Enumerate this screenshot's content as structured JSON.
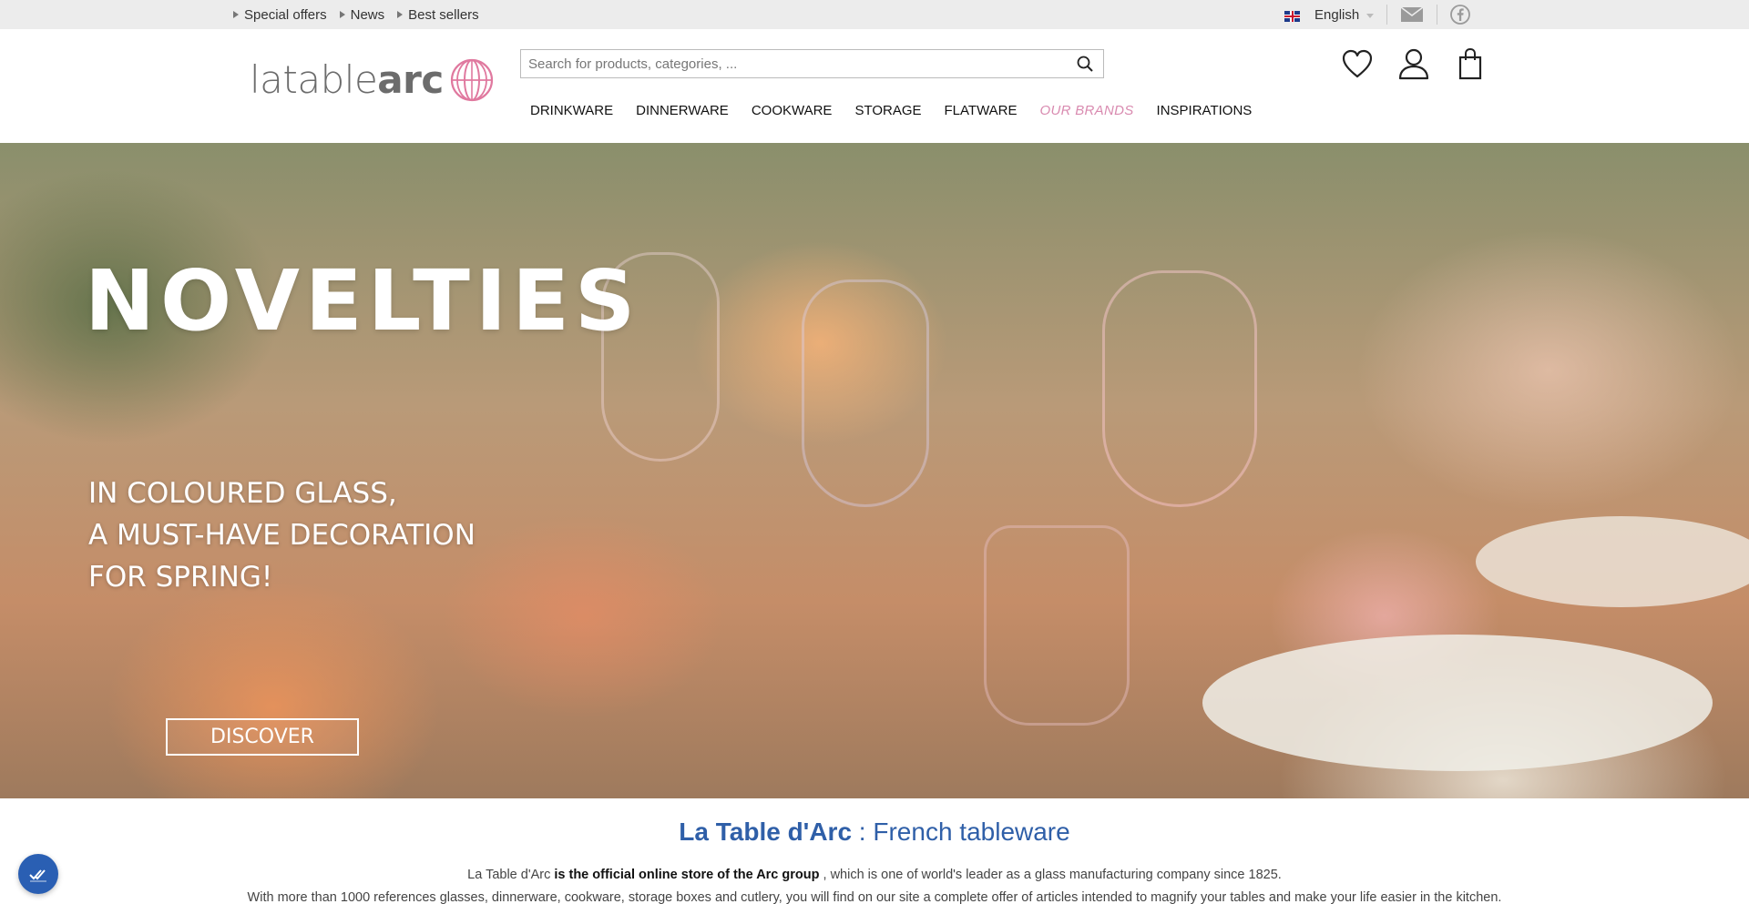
{
  "topbar": {
    "links": [
      "Special offers",
      "News",
      "Best sellers"
    ],
    "language": "English",
    "icons": [
      "mail-icon",
      "facebook-icon"
    ]
  },
  "header": {
    "logo_light": "latable",
    "logo_bold": "arc",
    "search_placeholder": "Search for products, categories, ...",
    "nav": [
      "DRINKWARE",
      "DINNERWARE",
      "COOKWARE",
      "STORAGE",
      "FLATWARE",
      "OUR BRANDS",
      "INSPIRATIONS"
    ],
    "icons": [
      "heart-icon",
      "user-icon",
      "bag-icon"
    ]
  },
  "hero": {
    "title": "NOVELTIES",
    "subtitle_lines": [
      "IN COLOURED GLASS,",
      "A MUST-HAVE DECORATION",
      "FOR SPRING!"
    ],
    "cta": "DISCOVER"
  },
  "intro": {
    "title_bold": "La Table d'Arc",
    "title_rest": " : French tableware",
    "p1_start": "La Table d'Arc ",
    "p1_bold": "is the official online store of the Arc group",
    "p1_end": " , which is one of world's leader as a glass manufacturing company since 1825.",
    "p2": "With more than 1000 references glasses, dinnerware, cookware, storage boxes and cutlery, you will find on our site a complete offer of articles intended to magnify your tables and make your life easier in the kitchen."
  },
  "colors": {
    "accent_blue": "#2f5fa8",
    "brand_pink": "#d98bb0",
    "topbar_bg": "#ececec"
  }
}
